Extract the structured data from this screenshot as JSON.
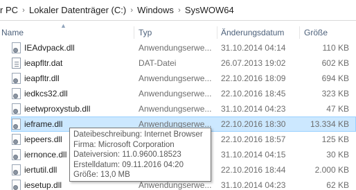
{
  "breadcrumb": {
    "items": [
      "r PC",
      "Lokaler Datenträger (C:)",
      "Windows",
      "SysWOW64"
    ],
    "separator": "›"
  },
  "columns": {
    "name": "Name",
    "type": "Typ",
    "date": "Änderungsdatum",
    "size": "Größe",
    "sorted_column": "name"
  },
  "files": [
    {
      "name": "IEAdvpack.dll",
      "type": "Anwendungserwe...",
      "date": "31.10.2014 04:14",
      "size": "110 KB",
      "icon": "dll-gear-icon"
    },
    {
      "name": "ieapfltr.dat",
      "type": "DAT-Datei",
      "date": "26.07.2013 19:02",
      "size": "602 KB",
      "icon": "dat-file-icon"
    },
    {
      "name": "ieapfltr.dll",
      "type": "Anwendungserwe...",
      "date": "22.10.2016 18:09",
      "size": "694 KB",
      "icon": "dll-gear-icon"
    },
    {
      "name": "iedkcs32.dll",
      "type": "Anwendungserwe...",
      "date": "22.10.2016 18:45",
      "size": "323 KB",
      "icon": "dll-gear-icon"
    },
    {
      "name": "ieetwproxystub.dll",
      "type": "Anwendungserwe...",
      "date": "31.10.2014 04:23",
      "size": "47 KB",
      "icon": "dll-gear-icon"
    },
    {
      "name": "ieframe.dll",
      "type": "Anwendungserwe...",
      "date": "22.10.2016 18:30",
      "size": "13.334 KB",
      "icon": "dll-gear-icon",
      "selected": true
    },
    {
      "name": "iepeers.dll",
      "type": "Anwendungserwe...",
      "date": "22.10.2016 18:57",
      "size": "125 KB",
      "icon": "dll-gear-icon"
    },
    {
      "name": "iernonce.dll",
      "type": "Anwendungserwe...",
      "date": "31.10.2014 04:15",
      "size": "30 KB",
      "icon": "dll-gear-icon"
    },
    {
      "name": "iertutil.dll",
      "type": "Anwendungserwe...",
      "date": "22.10.2016 18:44",
      "size": "2.000 KB",
      "icon": "dll-gear-icon"
    },
    {
      "name": "iesetup.dll",
      "type": "Anwendungserwe...",
      "date": "31.10.2014 04:23",
      "size": "62 KB",
      "icon": "dll-gear-icon"
    }
  ],
  "tooltip": {
    "lines": [
      "Dateibeschreibung: Internet Browser",
      "Firma: Microsoft Corporation",
      "Dateiversion: 11.0.9600.18523",
      "Erstelldatum: 09.11.2016 04:20",
      "Größe: 13,0 MB"
    ]
  },
  "colors": {
    "selection_bg": "#cce8ff",
    "selection_border": "#99d1ff",
    "header_text": "#4c607a",
    "secondary_text": "#6d6d6d"
  }
}
